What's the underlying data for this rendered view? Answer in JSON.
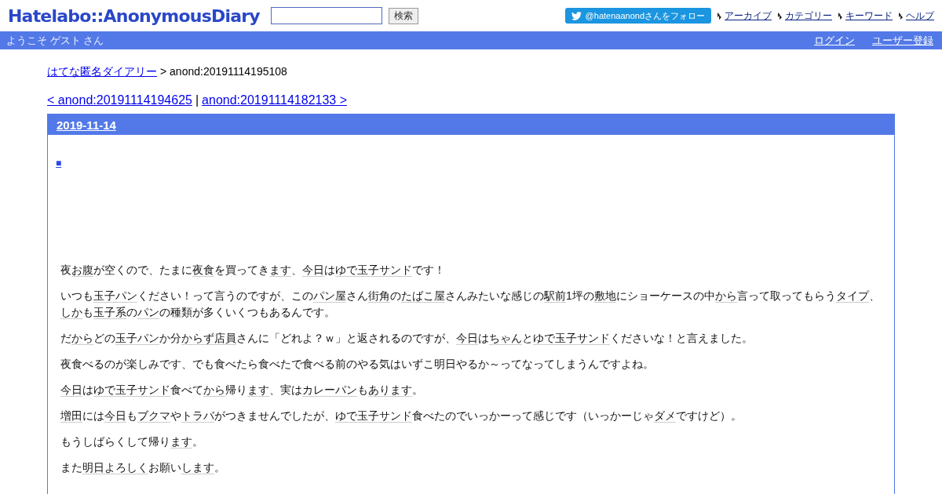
{
  "header": {
    "logo": "Hatelabo::AnonymousDiary",
    "search": {
      "button": "検索"
    },
    "follow_button": "@hatenaanondさんをフォロー",
    "nav": [
      "アーカイブ",
      "カテゴリー",
      "キーワード",
      "ヘルプ"
    ]
  },
  "bar": {
    "greeting": "ようこそ ゲスト さん",
    "links": [
      "ログイン",
      "ユーザー登録"
    ]
  },
  "breadcrumb": {
    "link": "はてな匿名ダイアリー",
    "current": "> anond:20191114195108"
  },
  "pager": {
    "prev": "< anond:20191114194625",
    "separator": "|",
    "next": "anond:20191114182133 >"
  },
  "day": {
    "date": "2019-11-14",
    "mark": "■",
    "paragraphs": [
      [
        {
          "text": "夜"
        },
        {
          "text": "お腹",
          "keyword": true
        },
        {
          "text": "が空くので、たまに"
        },
        {
          "text": "夜食",
          "keyword": true
        },
        {
          "text": "を買ってき"
        },
        {
          "text": "ます",
          "keyword": true
        },
        {
          "text": "、"
        },
        {
          "text": "今日",
          "keyword": true
        },
        {
          "text": "は"
        },
        {
          "text": "ゆで玉子サンド",
          "keyword": true
        },
        {
          "text": "です！"
        }
      ],
      [
        {
          "text": "いつも"
        },
        {
          "text": "玉子パン",
          "keyword": true
        },
        {
          "text": "ください！って言うのですが、この"
        },
        {
          "text": "パン屋",
          "keyword": true
        },
        {
          "text": "さん"
        },
        {
          "text": "街角",
          "keyword": true
        },
        {
          "text": "の"
        },
        {
          "text": "たばこ屋",
          "keyword": true
        },
        {
          "text": "さんみたいな感じの"
        },
        {
          "text": "駅前",
          "keyword": true
        },
        {
          "text": "1坪の"
        },
        {
          "text": "敷地",
          "keyword": true
        },
        {
          "text": "にショーケースの中"
        },
        {
          "text": "から",
          "keyword": true
        },
        {
          "text": "言って取ってもらう"
        },
        {
          "text": "タイプ",
          "keyword": true
        },
        {
          "text": "、"
        },
        {
          "text": "しか",
          "keyword": true
        },
        {
          "text": "も"
        },
        {
          "text": "玉子系",
          "keyword": true
        },
        {
          "text": "の"
        },
        {
          "text": "パン",
          "keyword": true
        },
        {
          "text": "の種類が多くいくつもあるんです。"
        }
      ],
      [
        {
          "text": "だ"
        },
        {
          "text": "から",
          "keyword": true
        },
        {
          "text": "どの"
        },
        {
          "text": "玉子パン",
          "keyword": true
        },
        {
          "text": "か分"
        },
        {
          "text": "からず",
          "keyword": true
        },
        {
          "text": "店員",
          "keyword": true
        },
        {
          "text": "さんに「どれよ？ｗ」と返されるのですが、"
        },
        {
          "text": "今日",
          "keyword": true
        },
        {
          "text": "は"
        },
        {
          "text": "ちゃん",
          "keyword": true
        },
        {
          "text": "と"
        },
        {
          "text": "ゆで玉子サンド",
          "keyword": true
        },
        {
          "text": "くださいな！と言えました。"
        }
      ],
      [
        {
          "text": "夜食べるのが楽しみです、でも食べたら食べたで食べる前のやる気はいずこ明日やるか～ってなってしまうんですよね。"
        }
      ],
      [
        {
          "text": "今日",
          "keyword": true
        },
        {
          "text": "は"
        },
        {
          "text": "ゆで玉子サンド",
          "keyword": true
        },
        {
          "text": "食べて"
        },
        {
          "text": "から",
          "keyword": true
        },
        {
          "text": "帰り"
        },
        {
          "text": "ます",
          "keyword": true
        },
        {
          "text": "、実は"
        },
        {
          "text": "カレーパン",
          "keyword": true
        },
        {
          "text": "も"
        },
        {
          "text": "あります",
          "keyword": true
        },
        {
          "text": "。"
        }
      ],
      [
        {
          "text": "増田",
          "keyword": true
        },
        {
          "text": "には"
        },
        {
          "text": "今日",
          "keyword": true
        },
        {
          "text": "も"
        },
        {
          "text": "ブクマ",
          "keyword": true
        },
        {
          "text": "や"
        },
        {
          "text": "トラバ",
          "keyword": true
        },
        {
          "text": "がつきませんでしたが、"
        },
        {
          "text": "ゆで玉子サンド",
          "keyword": true
        },
        {
          "text": "食べたのでいっかーって感じです（いっかーじゃ"
        },
        {
          "text": "ダメ",
          "keyword": true
        },
        {
          "text": "ですけど）。"
        }
      ],
      [
        {
          "text": "もうしばらくして帰り"
        },
        {
          "text": "ます",
          "keyword": true
        },
        {
          "text": "。"
        }
      ],
      [
        {
          "text": "また"
        },
        {
          "text": "明日よろしく",
          "keyword": true
        },
        {
          "text": "お願い"
        },
        {
          "text": "します",
          "keyword": true
        },
        {
          "text": "。"
        }
      ]
    ]
  }
}
